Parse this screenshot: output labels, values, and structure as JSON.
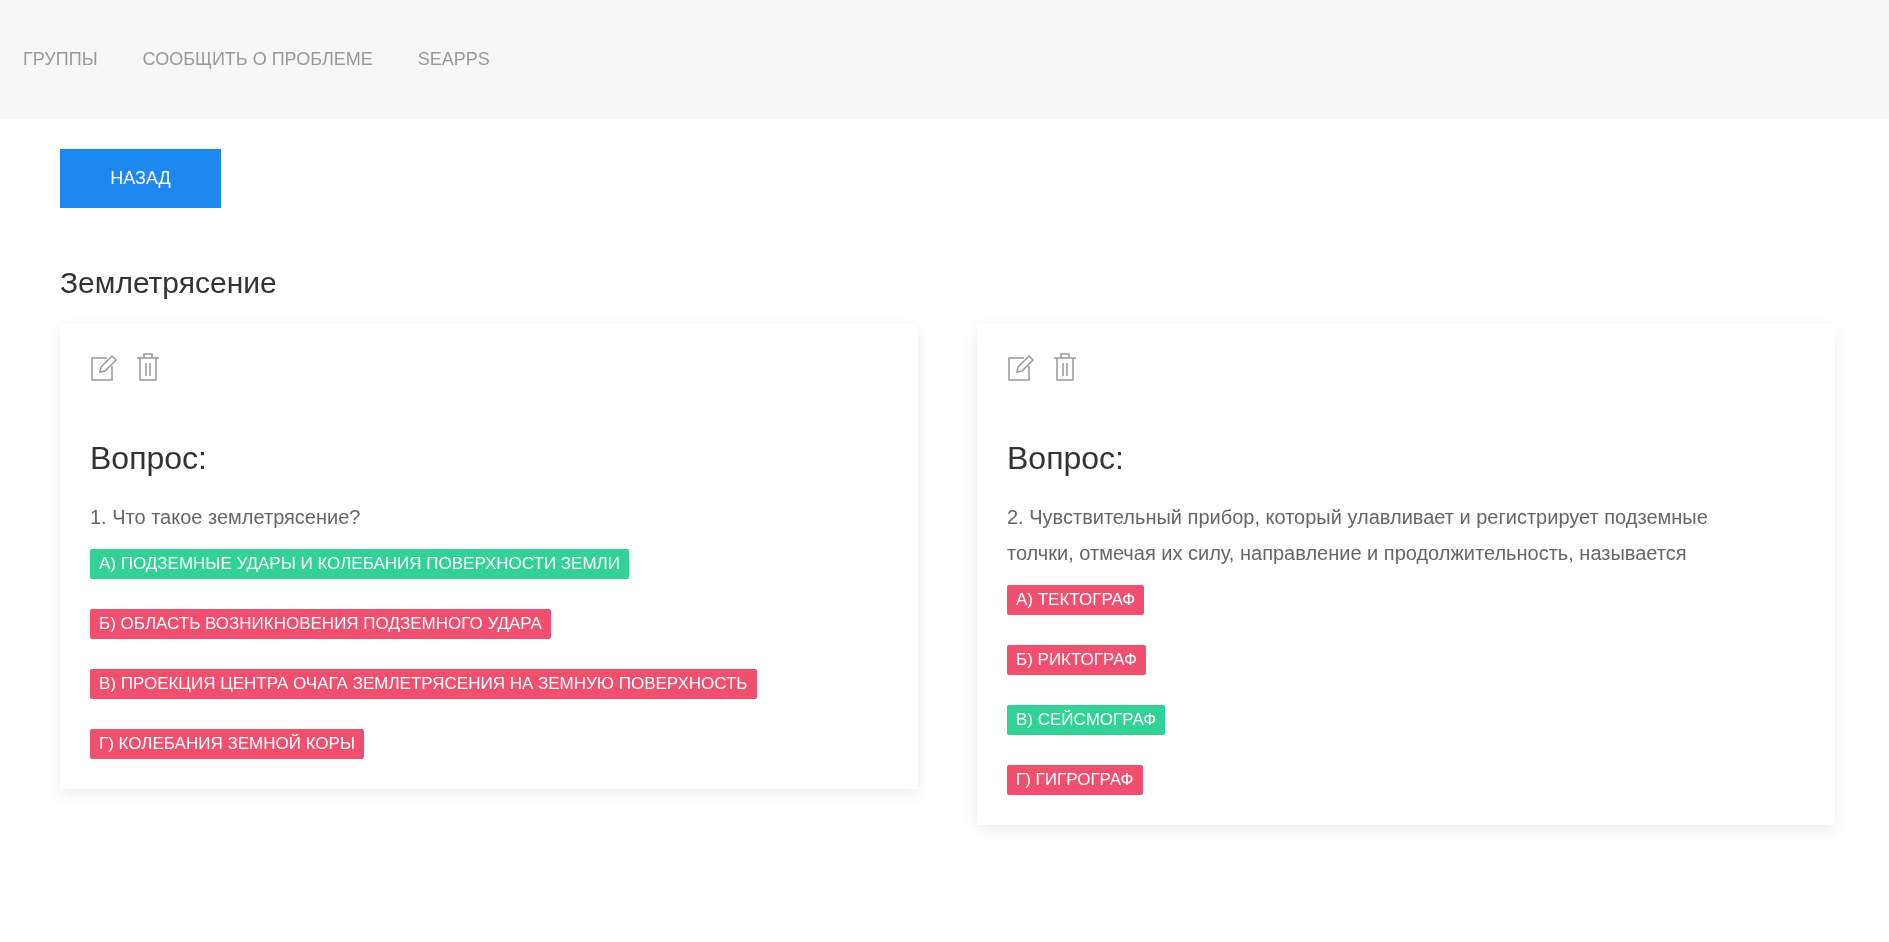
{
  "nav": {
    "items": [
      {
        "label": "ГРУППЫ"
      },
      {
        "label": "СООБЩИТЬ О ПРОБЛЕМЕ"
      },
      {
        "label": "SEAPPS"
      }
    ]
  },
  "back_button": {
    "label": "НАЗАД"
  },
  "title": "Землетрясение",
  "questions": [
    {
      "heading": "Вопрос:",
      "text": "1. Что такое землетрясение?",
      "answers": [
        {
          "label": "А) ПОДЗЕМНЫЕ УДАРЫ И КОЛЕБАНИЯ ПОВЕРХНОСТИ ЗЕМЛИ",
          "correct": true
        },
        {
          "label": "Б) ОБЛАСТЬ ВОЗНИКНОВЕНИЯ ПОДЗЕМНОГО УДАРА",
          "correct": false
        },
        {
          "label": "В) ПРОЕКЦИЯ ЦЕНТРА ОЧАГА ЗЕМЛЕТРЯСЕНИЯ НА ЗЕМНУЮ ПОВЕРХНОСТЬ",
          "correct": false
        },
        {
          "label": "Г) КОЛЕБАНИЯ ЗЕМНОЙ КОРЫ",
          "correct": false
        }
      ]
    },
    {
      "heading": "Вопрос:",
      "text": "2. Чувствительный прибор, который улавливает и регистрирует подземные толчки, отмечая их силу, направление и продолжительность, называется",
      "answers": [
        {
          "label": "А) ТЕКТОГРАФ",
          "correct": false
        },
        {
          "label": "Б) РИКТОГРАФ",
          "correct": false
        },
        {
          "label": "В) СЕЙСМОГРАФ",
          "correct": true
        },
        {
          "label": "Г) ГИГРОГРАФ",
          "correct": false
        }
      ]
    }
  ]
}
